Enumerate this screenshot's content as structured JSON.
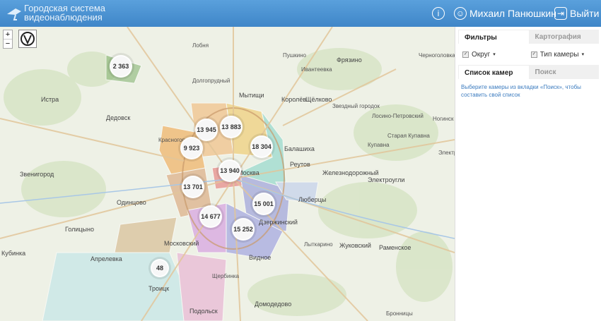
{
  "header": {
    "title_line1": "Городская система",
    "title_line2": "видеонаблюдения",
    "info_icon": "info-icon",
    "user_name": "Михаил Панюшкин",
    "logout_label": "Выйти"
  },
  "map": {
    "zoom_in": "+",
    "zoom_out": "−",
    "clusters": [
      "2 363",
      "13 945",
      "13 883",
      "9 923",
      "18 304",
      "13 940",
      "13 701",
      "15 001",
      "14 677",
      "15 252",
      "48"
    ],
    "labels": [
      "Пушкино",
      "Королёв",
      "Мытищи",
      "Балашиха",
      "Реутов",
      "Москва",
      "Одинцово",
      "Видное",
      "Домодедово",
      "Подольск",
      "Люберцы",
      "Жуковский",
      "Лыткарино",
      "Раменское",
      "Щёлково",
      "Ивантеевка",
      "Фрязино",
      "Истра",
      "Дедовск",
      "Звенигород",
      "Голицыно",
      "Кубинка",
      "Апрелевка",
      "Троицк",
      "Московский",
      "Красногорск",
      "Электроугли",
      "Железнодорожный",
      "Дзержинский",
      "Купавна",
      "Старая Купавна",
      "Лосино-Петровский",
      "Звездный городок",
      "Черноголовка",
      "Лобня",
      "Долгопрудный",
      "Щербинка",
      "Бронницы",
      "Ногинск",
      "Электросталь"
    ]
  },
  "panel": {
    "tabs": [
      "Фильтры",
      "Картография"
    ],
    "filters": [
      "Округ",
      "Тип камеры"
    ],
    "subtabs": [
      "Список камер",
      "Поиск"
    ],
    "hint": "Выберите камеры из вкладки «Поиск», чтобы составить свой список"
  },
  "colors": {
    "header": "#4a91d2",
    "accent": "#3b7bbf"
  }
}
